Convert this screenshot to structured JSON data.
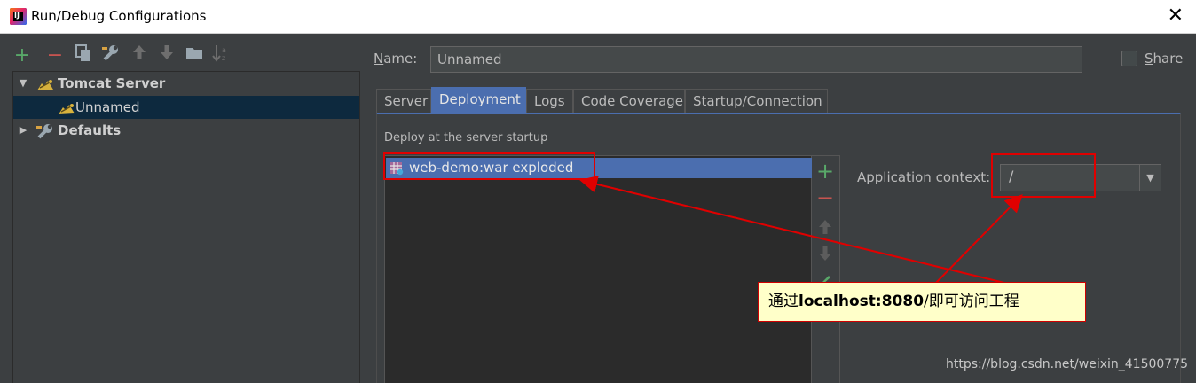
{
  "window": {
    "title": "Run/Debug Configurations",
    "close_glyph": "✕"
  },
  "toolbar": {
    "items": [
      {
        "name": "add-icon",
        "glyph": "+",
        "color": "#59a869"
      },
      {
        "name": "remove-icon",
        "glyph": "−",
        "color": "#c75450"
      },
      {
        "name": "copy-icon",
        "glyph": "⧉",
        "color": "#9aa7b0"
      },
      {
        "name": "wrench-icon",
        "glyph": "🔧",
        "color": "#9aa7b0"
      },
      {
        "name": "move-up-icon",
        "glyph": "⬆",
        "color": "#6e6e6e"
      },
      {
        "name": "move-down-icon",
        "glyph": "⬇",
        "color": "#6e6e6e"
      },
      {
        "name": "folder-icon",
        "glyph": "▰",
        "color": "#9aa7b0"
      },
      {
        "name": "sort-icon",
        "glyph": "↓ᶻ",
        "color": "#6e6e6e"
      }
    ]
  },
  "tree": {
    "tomcat_server": "Tomcat Server",
    "unnamed": "Unnamed",
    "defaults": "Defaults"
  },
  "name_field": {
    "label_prefix": "N",
    "label_rest": "ame:",
    "value": "Unnamed"
  },
  "share": {
    "label_prefix": "S",
    "label_rest": "hare",
    "checked": false
  },
  "tabs": [
    {
      "label": "Server",
      "active": false
    },
    {
      "label": "Deployment",
      "active": true
    },
    {
      "label": "Logs",
      "active": false
    },
    {
      "label": "Code Coverage",
      "active": false
    },
    {
      "label": "Startup/Connection",
      "active": false
    }
  ],
  "deployment": {
    "section_title": "Deploy at the server startup",
    "artifacts": [
      "web-demo:war exploded"
    ],
    "side_tools": [
      {
        "name": "add-artifact-icon",
        "glyph": "+",
        "color": "#59a869"
      },
      {
        "name": "remove-artifact-icon",
        "glyph": "−",
        "color": "#c75450"
      },
      {
        "name": "move-up-artifact-icon",
        "glyph": "⬆",
        "color": "#6e6e6e"
      },
      {
        "name": "move-down-artifact-icon",
        "glyph": "⬇",
        "color": "#6e6e6e"
      },
      {
        "name": "edit-artifact-icon",
        "glyph": "✎",
        "color": "#59a869"
      }
    ],
    "application_context_label": "Application context:",
    "application_context_value": "/"
  },
  "annotation": {
    "callout_prefix": "通过",
    "callout_bold": "localhost:8080",
    "callout_suffix": "/即可访问工程",
    "highlight_color": "#e00000"
  },
  "watermark": "https://blog.csdn.net/weixin_41500775"
}
